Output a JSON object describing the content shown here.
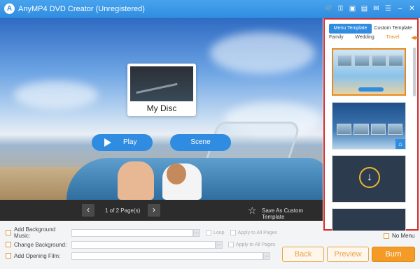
{
  "app": {
    "title": "AnyMP4 DVD Creator (Unregistered)",
    "logo_icon": "app-logo"
  },
  "titlebar_icons": [
    "cart-icon",
    "key-icon",
    "save-icon",
    "file-icon",
    "feedback-icon",
    "menu-icon",
    "minimize-icon",
    "close-icon"
  ],
  "preview": {
    "disc_title": "My Disc",
    "play_label": "Play",
    "scene_label": "Scene"
  },
  "pager": {
    "page_label": "1 of 2 Page(s)",
    "save_template_label": "Save As Custom Template"
  },
  "options": {
    "background_music_label": "Add Background Music:",
    "change_background_label": "Change Background:",
    "opening_film_label": "Add Opening Film:",
    "loop_label": "Loop",
    "apply_all_label": "Apply to All Pages",
    "browse_label": "..."
  },
  "template_panel": {
    "tabs": [
      "Menu Template",
      "Custom Template"
    ],
    "active_tab": "Menu Template",
    "categories": [
      "Family",
      "Wedding",
      "Travel"
    ],
    "selected_category": "Travel"
  },
  "no_menu_label": "No Menu",
  "buttons": {
    "back": "Back",
    "preview": "Preview",
    "burn": "Burn"
  },
  "colors": {
    "accent": "#2f8ce0",
    "orange": "#f39a27",
    "panel_border": "#d62a2a"
  }
}
